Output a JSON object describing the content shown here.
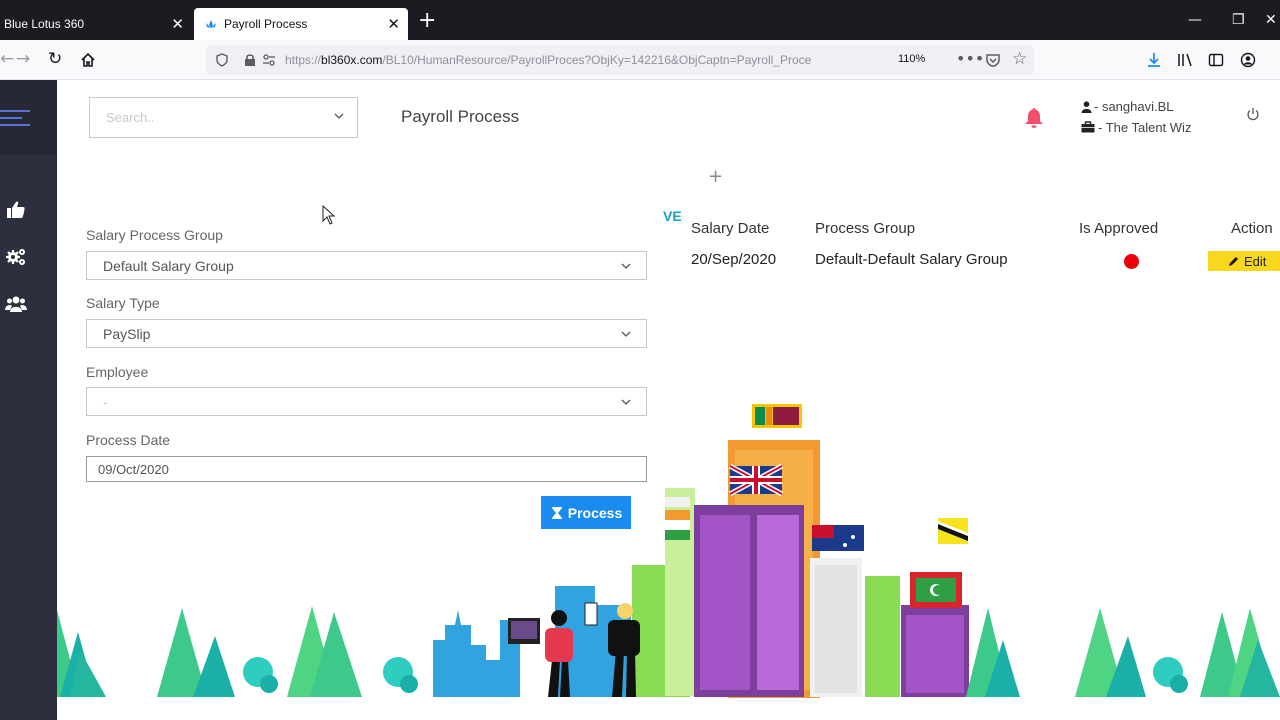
{
  "browser": {
    "tabs": [
      {
        "title": "Blue Lotus 360"
      },
      {
        "title": "Payroll Process"
      }
    ],
    "url_prefix": "https://",
    "url_domain": "bl360x.com",
    "url_rest": "/BL10/HumanResource/PayrollProces?ObjKy=142216&ObjCaptn=Payroll_Proce",
    "zoom": "110%"
  },
  "header": {
    "search_placeholder": "Search..",
    "page_title": "Payroll Process",
    "user_name": "- sanghavi.BL",
    "company_name": "- The Talent Wiz"
  },
  "form": {
    "salary_group_label": "Salary Process Group",
    "salary_group_value": "Default Salary Group",
    "salary_type_label": "Salary Type",
    "salary_type_value": "PaySlip",
    "employee_label": "Employee",
    "employee_value": "-",
    "process_date_label": "Process Date",
    "process_date_value": "09/Oct/2020",
    "process_button": "Process"
  },
  "table": {
    "partial_header": "VE",
    "columns": [
      "Salary Date",
      "Process Group",
      "Is Approved",
      "Action"
    ],
    "rows": [
      {
        "salary_date": "20/Sep/2020",
        "process_group": "Default-Default Salary Group",
        "is_approved": false,
        "action": "Edit"
      }
    ]
  },
  "colors": {
    "sidebar": "#2d2f3e",
    "accent": "#1a8cf0",
    "approved_status": "#e8000b",
    "edit_button": "#f9d71c",
    "bell": "#f0506e"
  }
}
